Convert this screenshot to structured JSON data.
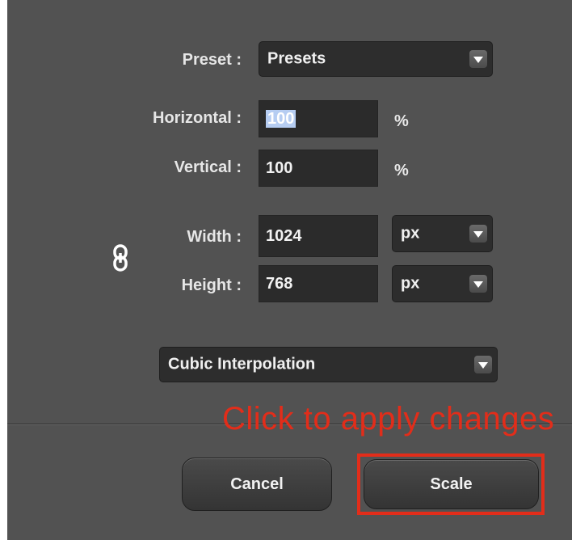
{
  "preset": {
    "label": "Preset :",
    "value": "Presets"
  },
  "horizontal": {
    "label": "Horizontal :",
    "value": "100",
    "unit": "%"
  },
  "vertical": {
    "label": "Vertical :",
    "value": "100",
    "unit": "%"
  },
  "width": {
    "label": "Width :",
    "value": "1024",
    "unit": "px"
  },
  "height": {
    "label": "Height :",
    "value": "768",
    "unit": "px"
  },
  "interpolation": {
    "value": "Cubic Interpolation"
  },
  "annotation": {
    "text": "Click to apply changes",
    "color": "#e22d1a"
  },
  "buttons": {
    "cancel": "Cancel",
    "scale": "Scale"
  },
  "icons": {
    "link": "chain-link-icon",
    "dropdown": "chevron-down-icon"
  }
}
